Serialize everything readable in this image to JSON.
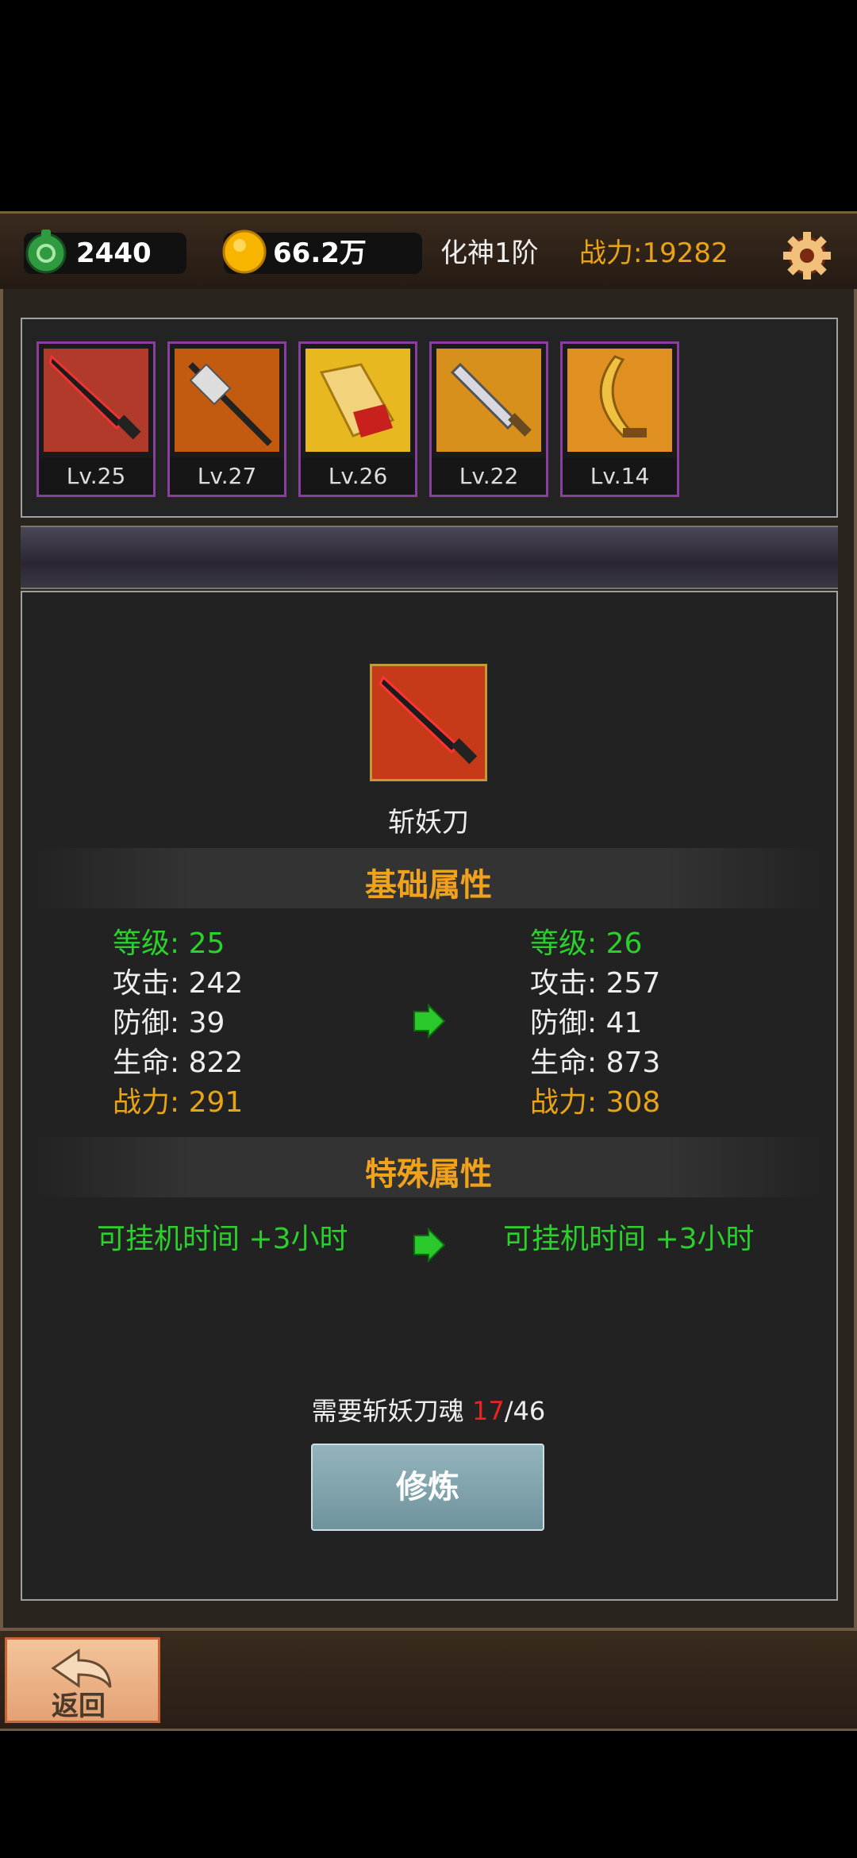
{
  "currency": {
    "jade": "2440",
    "gold": "66.2万"
  },
  "realm": "化神1阶",
  "combat_power": "战力:19282",
  "icons": {
    "jade": "jade-gem-icon",
    "gold": "gold-coin-icon",
    "settings": "gear-icon",
    "back": "return-arrow-icon"
  },
  "weapons": [
    {
      "level": "Lv.25"
    },
    {
      "level": "Lv.27"
    },
    {
      "level": "Lv.26"
    },
    {
      "level": "Lv.22"
    },
    {
      "level": "Lv.14"
    }
  ],
  "selected": {
    "name": "斩妖刀"
  },
  "basic_title": "基础属性",
  "current": {
    "level_key": "等级:",
    "level_val": "25",
    "atk_key": "攻击:",
    "atk_val": "242",
    "def_key": "防御:",
    "def_val": "39",
    "hp_key": "生命:",
    "hp_val": "822",
    "pow_key": "战力:",
    "pow_val": "291"
  },
  "next": {
    "level_key": "等级:",
    "level_val": "26",
    "atk_key": "攻击:",
    "atk_val": "257",
    "def_key": "防御:",
    "def_val": "41",
    "hp_key": "生命:",
    "hp_val": "873",
    "pow_key": "战力:",
    "pow_val": "308"
  },
  "special_title": "特殊属性",
  "special": {
    "current": "可挂机时间 +3小时",
    "next": "可挂机时间 +3小时"
  },
  "requirement": {
    "label": "需要斩妖刀魂",
    "current": "17",
    "total": "/46"
  },
  "train_button": "修炼",
  "back_label": "返回",
  "colors": {
    "gold": "#e9a416",
    "green": "#2bd12b",
    "purple_frame": "#8a3fa0"
  }
}
